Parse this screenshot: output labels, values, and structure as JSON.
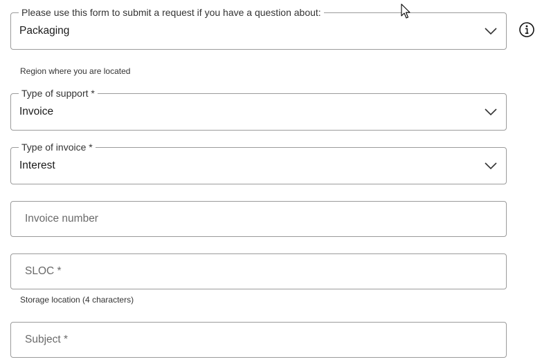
{
  "question_field": {
    "legend": "Please use this form to submit a request if you have a question about:",
    "value": "Packaging",
    "chevron_icon": "chevron-down-icon",
    "info_icon": "info-icon"
  },
  "region_helper": "Region where you are located",
  "support_type_field": {
    "legend": "Type of support *",
    "value": "Invoice",
    "chevron_icon": "chevron-down-icon"
  },
  "invoice_type_field": {
    "legend": "Type of invoice *",
    "value": "Interest",
    "chevron_icon": "chevron-down-icon"
  },
  "invoice_number_field": {
    "placeholder": "Invoice number",
    "value": ""
  },
  "sloc_field": {
    "placeholder": "SLOC *",
    "value": "",
    "helper": "Storage location (4 characters)"
  },
  "subject_field": {
    "placeholder": "Subject *",
    "value": ""
  },
  "colors": {
    "border": "#9a9a9a",
    "text": "#1a1a1a",
    "placeholder": "#6a6a6a"
  },
  "cursor_icon": "mouse-pointer-icon"
}
